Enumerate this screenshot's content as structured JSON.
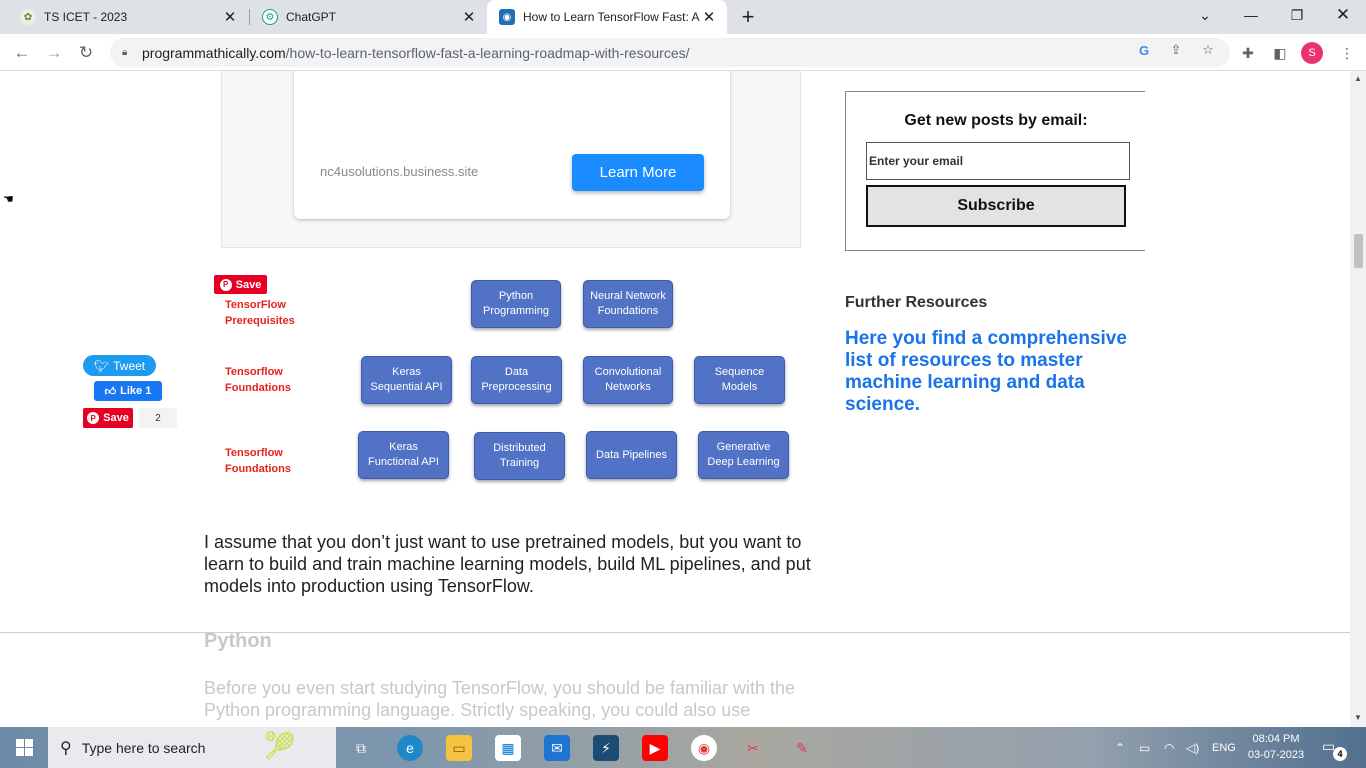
{
  "browser": {
    "tabs": [
      {
        "title": "TS ICET - 2023",
        "active": false
      },
      {
        "title": "ChatGPT",
        "active": false
      },
      {
        "title": "How to Learn TensorFlow Fast: A",
        "active": true
      }
    ],
    "new_tab_symbol": "+",
    "url_domain": "programmathically.com",
    "url_path": "/how-to-learn-tensorflow-fast-a-learning-roadmap-with-resources/",
    "profile_initial": "S"
  },
  "ad": {
    "domain": "nc4usolutions.business.site",
    "button_label": "Learn More"
  },
  "share": {
    "tweet": "Tweet",
    "like": "Like 1",
    "save": "Save",
    "save_count": "2"
  },
  "diagram": {
    "pin_save": "Save",
    "row_labels": [
      "TensorFlow Prerequisites",
      "Tensorflow Foundations",
      "Tensorflow Foundations"
    ],
    "row1": [
      "Python Programming",
      "Neural Network Foundations"
    ],
    "row2": [
      "Keras Sequential API",
      "Data Preprocessing",
      "Convolutional Networks",
      "Sequence Models"
    ],
    "row3": [
      "Keras Functional API",
      "Distributed Training",
      "Data Pipelines",
      "Generative Deep Learning"
    ]
  },
  "article": {
    "paragraph": "I assume that you don’t just want to use pretrained models, but you want to learn to build and train machine learning models, build ML pipelines, and put models into production using TensorFlow.",
    "section_heading": "Python",
    "faded_paragraph": "Before you even start studying TensorFlow, you should be familiar with the Python programming language. Strictly speaking, you could also use"
  },
  "sidebar": {
    "email_heading": "Get new posts by email:",
    "email_placeholder": "Enter your email",
    "subscribe_label": "Subscribe",
    "further_heading": "Further Resources",
    "further_link": "Here you find a comprehensive list of resources to master machine learning and data science."
  },
  "taskbar": {
    "search_placeholder": "Type here to search",
    "language": "ENG",
    "time": "08:04 PM",
    "date": "03-07-2023",
    "notification_count": "4"
  }
}
